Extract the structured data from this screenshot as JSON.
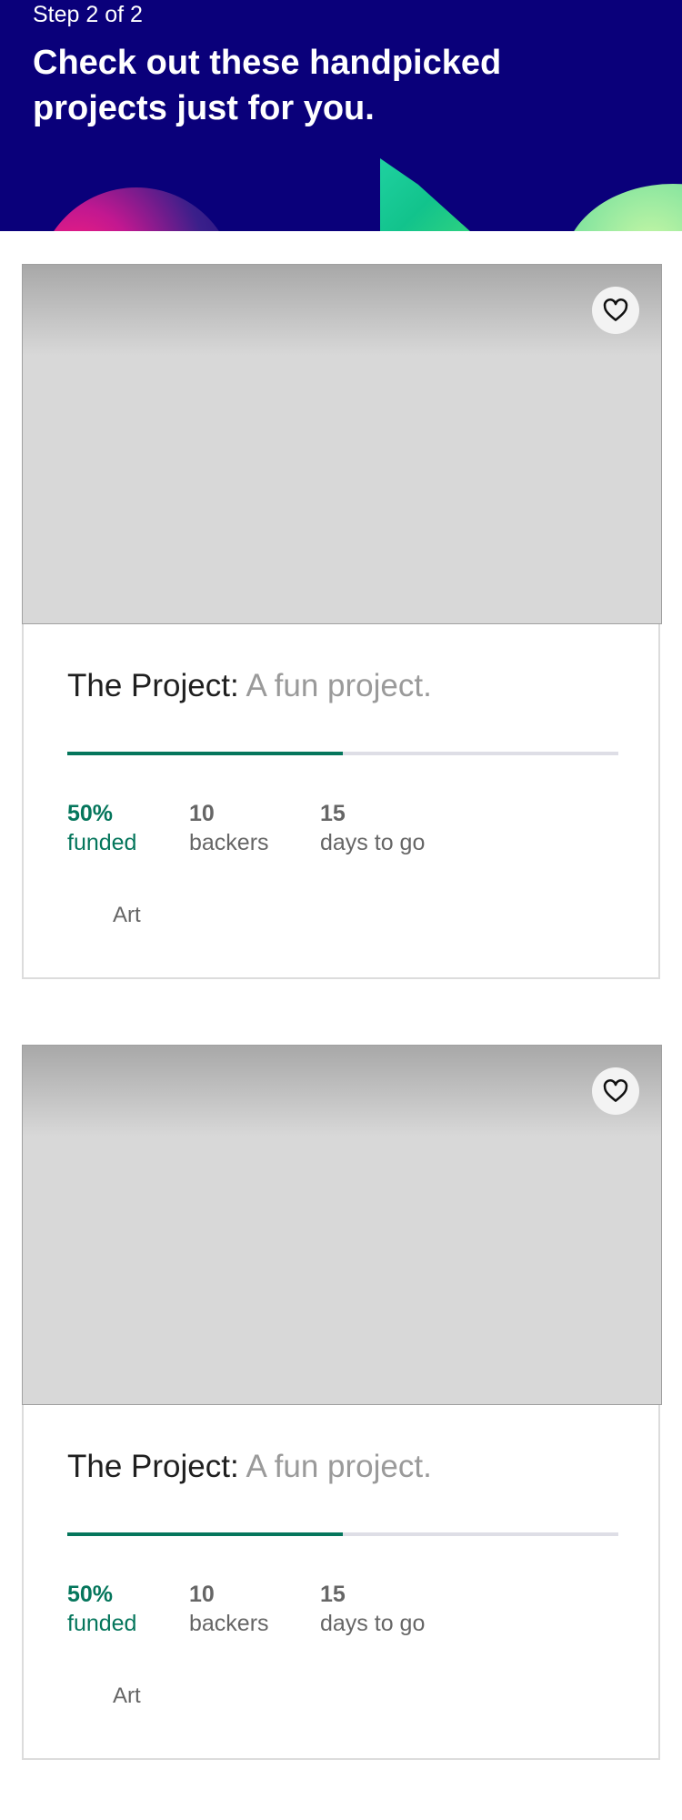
{
  "header": {
    "step": "Step 2 of 2",
    "headline": "Check out these handpicked projects just for you."
  },
  "colors": {
    "header_bg": "#0a007a",
    "accent_green": "#05765c",
    "progress_track": "#dedee6"
  },
  "projects": [
    {
      "name": "The Project:",
      "blurb": "A fun project.",
      "funded_fraction": 0.5,
      "funded_pct": "50%",
      "funded_label": "funded",
      "backers_count": "10",
      "backers_label": "backers",
      "days_count": "15",
      "days_label": "days to go",
      "category": "Art",
      "save_icon": "heart-icon"
    },
    {
      "name": "The Project:",
      "blurb": "A fun project.",
      "funded_fraction": 0.5,
      "funded_pct": "50%",
      "funded_label": "funded",
      "backers_count": "10",
      "backers_label": "backers",
      "days_count": "15",
      "days_label": "days to go",
      "category": "Art",
      "save_icon": "heart-icon"
    }
  ]
}
